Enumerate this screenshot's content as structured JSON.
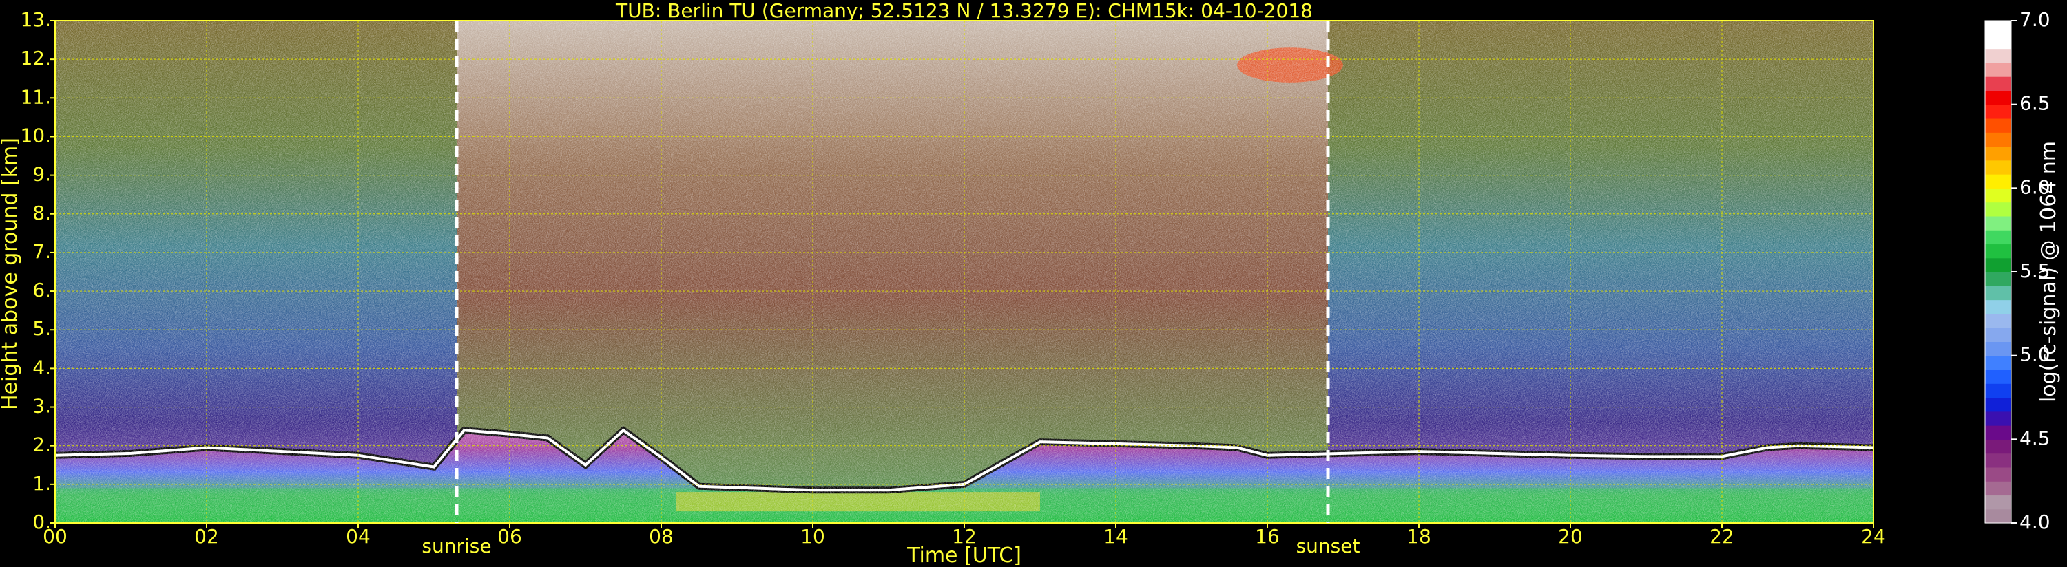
{
  "chart_data": {
    "type": "heatmap",
    "title": "TUB: Berlin TU (Germany; 52.5123 N / 13.3279 E):    CHM15k: 04-10-2018",
    "xlabel": "Time [UTC]",
    "ylabel": "Height above ground [km]",
    "xlim": [
      0,
      24
    ],
    "ylim": [
      0,
      13
    ],
    "x_ticks": [
      0,
      2,
      4,
      6,
      8,
      10,
      12,
      14,
      16,
      18,
      20,
      22,
      24
    ],
    "x_tick_labels": [
      "00",
      "02",
      "04",
      "06",
      "08",
      "10",
      "12",
      "14",
      "16",
      "18",
      "20",
      "22",
      "24"
    ],
    "y_ticks": [
      0,
      1,
      2,
      3,
      4,
      5,
      6,
      7,
      8,
      9,
      10,
      11,
      12,
      13
    ],
    "y_tick_labels": [
      "0.",
      "1.",
      "2.",
      "3.",
      "4.",
      "5.",
      "6.",
      "7.",
      "8.",
      "9.",
      "10.",
      "11.",
      "12.",
      "13."
    ],
    "grid": true,
    "events": [
      {
        "label": "sunrise",
        "time": 5.3
      },
      {
        "label": "sunset",
        "time": 16.8
      }
    ],
    "colorbar": {
      "label": "log(rc-signal) @ 1064 nm",
      "range": [
        4.0,
        7.0
      ],
      "tick_values": [
        4.0,
        4.5,
        5.0,
        5.5,
        6.0,
        6.5,
        7.0
      ],
      "tick_labels": [
        "4.0",
        "4.5",
        "5.0",
        "5.5",
        "6.0",
        "6.5",
        "7.0"
      ],
      "colors": [
        "#a88a9e",
        "#b097a8",
        "#a56a92",
        "#9a4a86",
        "#8a3080",
        "#7a1a7a",
        "#6a0a8a",
        "#3a10b0",
        "#1020d8",
        "#1040f0",
        "#2060ff",
        "#4080ff",
        "#6a96f2",
        "#86a8ee",
        "#9ab8ee",
        "#90d0e8",
        "#60c0a8",
        "#30a860",
        "#10a030",
        "#20c040",
        "#40d860",
        "#80f080",
        "#b0ff40",
        "#e0ff20",
        "#ffee00",
        "#ffc800",
        "#ffa000",
        "#ff7800",
        "#ff5000",
        "#ff2010",
        "#f00000",
        "#e84050",
        "#f0a0a0",
        "#f0d0d0",
        "#ffffff",
        "#ffffff"
      ]
    },
    "features": {
      "boundary_layer_top_km": [
        [
          0,
          1.75
        ],
        [
          1,
          1.8
        ],
        [
          2,
          1.95
        ],
        [
          3,
          1.85
        ],
        [
          4,
          1.75
        ],
        [
          5.0,
          1.45
        ],
        [
          5.4,
          2.4
        ],
        [
          6,
          2.3
        ],
        [
          6.5,
          2.2
        ],
        [
          7,
          1.5
        ],
        [
          7.5,
          2.4
        ],
        [
          8,
          1.7
        ],
        [
          8.5,
          0.95
        ],
        [
          10,
          0.85
        ],
        [
          11,
          0.85
        ],
        [
          12,
          1.0
        ],
        [
          13,
          2.1
        ],
        [
          14,
          2.05
        ],
        [
          15,
          2.0
        ],
        [
          15.6,
          1.95
        ],
        [
          16,
          1.75
        ],
        [
          17,
          1.8
        ],
        [
          18,
          1.85
        ],
        [
          19,
          1.8
        ],
        [
          20,
          1.75
        ],
        [
          21,
          1.72
        ],
        [
          22,
          1.72
        ],
        [
          22.6,
          1.95
        ],
        [
          23,
          2.0
        ],
        [
          24,
          1.95
        ]
      ],
      "cirrus_clouds": [
        {
          "time": [
            15.6,
            17.0
          ],
          "height_km": [
            11.4,
            12.3
          ]
        }
      ],
      "high_signal_daytime": [
        5.3,
        16.8
      ]
    }
  }
}
